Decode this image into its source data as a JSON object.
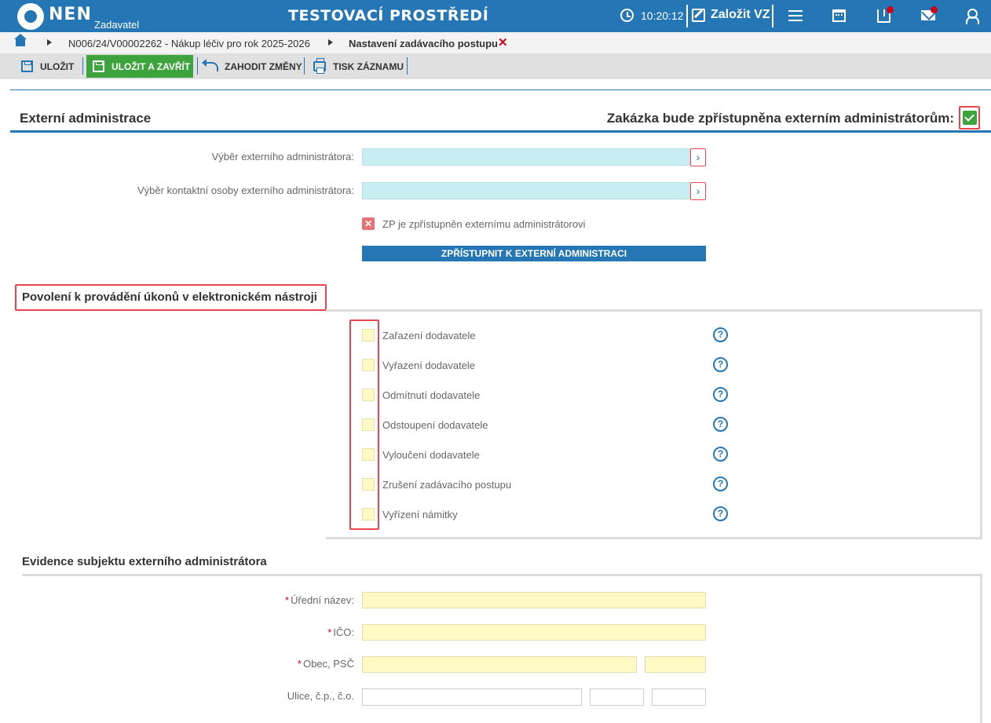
{
  "header": {
    "logo": "NEN",
    "logo_sub": "Zadavatel",
    "env_title": "TESTOVACÍ PROSTŘEDÍ",
    "clock": "10:20:12",
    "new_vz": "Založit VZ"
  },
  "breadcrumb": {
    "item1": "N006/24/V00002262 - Nákup léčiv pro rok 2025-2026",
    "item2": "Nastavení zadávacího postupu",
    "close": "✕"
  },
  "toolbar": {
    "save": "ULOŽIT",
    "save_close": "ULOŽIT A ZAVŘÍT",
    "discard": "ZAHODIT ZMĚNY",
    "print": "TISK ZÁZNAMU"
  },
  "external_admin": {
    "title": "Externí administrace",
    "access_label": "Zakázka bude zpřístupněna externím administrátorům:",
    "admin_select_label": "Výběr externího administrátora:",
    "contact_select_label": "Výběr kontaktní osoby externího administrátora:",
    "arrow": "›",
    "status_x": "✕",
    "status_text": "ZP je zpřístupněn externímu administrátorovi",
    "grant_button": "ZPŘÍSTUPNIT K EXTERNÍ ADMINISTRACI"
  },
  "permissions": {
    "title": "Povolení k provádění úkonů v elektronickém nástroji",
    "help": "?",
    "items": [
      "Zařazení dodavatele",
      "Vyřazení dodavatele",
      "Odmítnutí dodavatele",
      "Odstoupení dodavatele",
      "Vyloučení dodavatele",
      "Zrušení zadávacího postupu",
      "Vyřízení námitky"
    ]
  },
  "evidence": {
    "title": "Evidence subjektu externího administrátora",
    "required_mark": "*",
    "official_name": "Úřední název:",
    "ico": "IČO:",
    "city_zip": "Obec, PSČ",
    "street": "Ulice, č.p., č.o."
  }
}
